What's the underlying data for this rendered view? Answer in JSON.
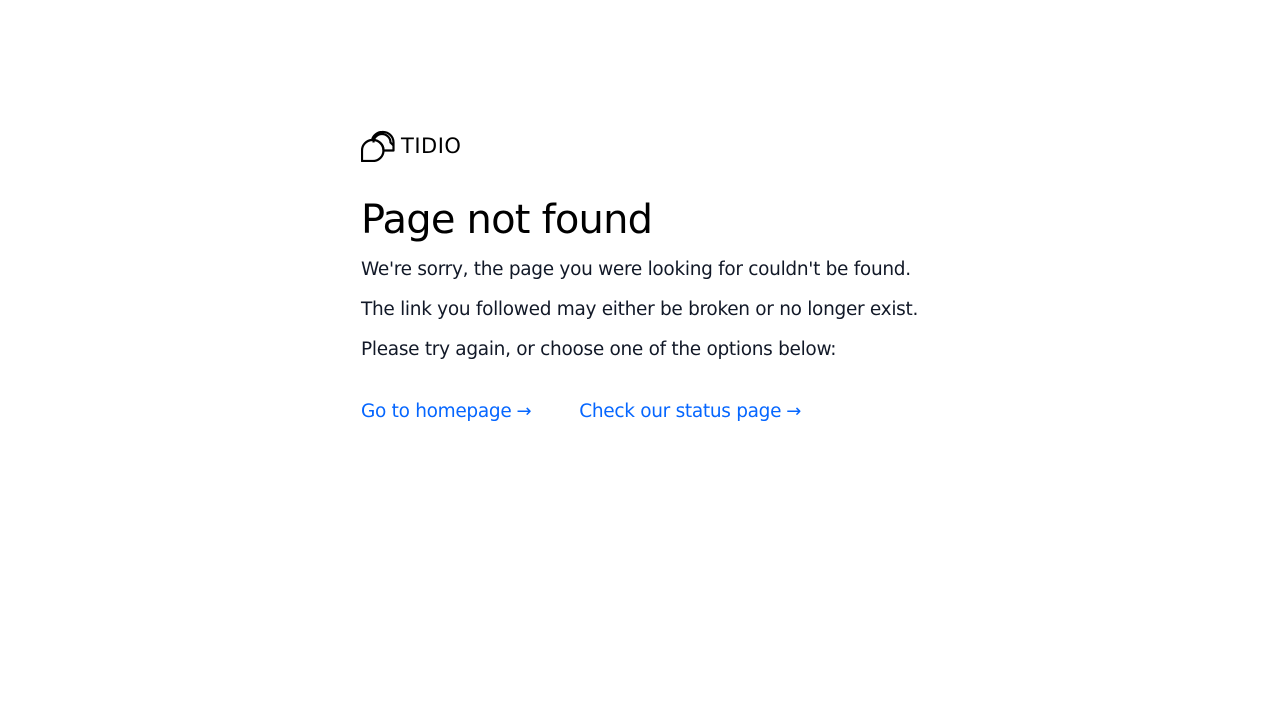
{
  "brand": {
    "name": "TIDIO",
    "icon": "tidio-logo-icon"
  },
  "error": {
    "title": "Page not found",
    "messages": [
      "We're sorry, the page you were looking for couldn't be found.",
      "The link you followed may either be broken or no longer exist.",
      "Please try again, or choose one of the options below:"
    ]
  },
  "links": [
    {
      "label": "Go to homepage",
      "arrow": "→",
      "icon": "arrow-right-icon"
    },
    {
      "label": "Check our status page",
      "arrow": "→",
      "icon": "arrow-right-icon"
    }
  ],
  "colors": {
    "link": "#0566ff",
    "text": "#111827",
    "heading": "#000000",
    "background": "#ffffff"
  }
}
